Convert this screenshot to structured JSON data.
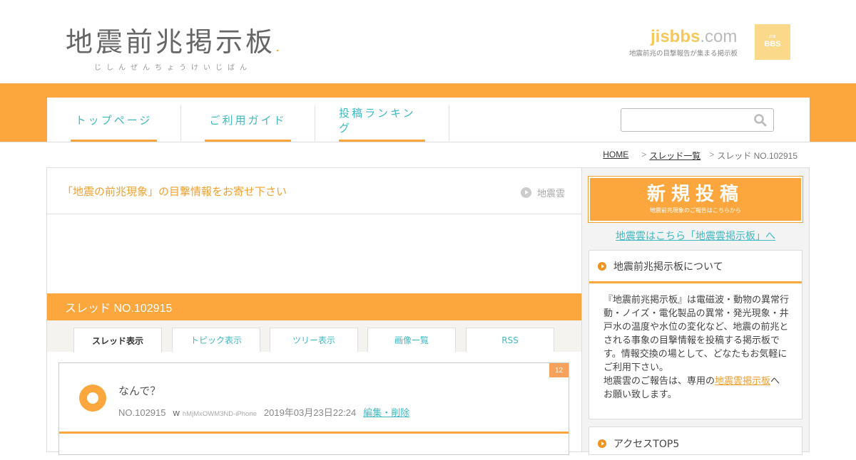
{
  "header": {
    "logo_title": "地震前兆掲示板",
    "logo_reading": "じしんぜんちょうけいじばん",
    "domain_main": "jisbbs",
    "domain_suffix": ".com",
    "tagline": "地震前兆の目撃報告が集まる掲示板",
    "badge_small": "JIS",
    "badge_label": "BBS"
  },
  "nav": {
    "items": [
      {
        "label": "トップページ"
      },
      {
        "label": "ご利用ガイド"
      },
      {
        "label": "投稿ランキング"
      }
    ],
    "search_placeholder": ""
  },
  "breadcrumb": {
    "home": "HOME",
    "sep": ">",
    "threads": "スレッド一覧",
    "current": "スレッド NO.102915"
  },
  "main": {
    "heading": "「地震の前兆現象」の目撃情報をお寄せ下さい",
    "tag": "地震雲",
    "thread_title": "スレッド NO.102915",
    "tabs": [
      {
        "label": "スレッド表示"
      },
      {
        "label": "トピック表示"
      },
      {
        "label": "ツリー表示"
      },
      {
        "label": "画像一覧"
      },
      {
        "label": "RSS"
      }
    ],
    "post": {
      "number_badge": "12",
      "title": "なんで？",
      "no": "NO.102915",
      "author_mark": "w",
      "author_id": "hMjMxOWM3ND-iPhone",
      "date": "2019年03月23日22:24",
      "edit_link": "編集・削除"
    }
  },
  "sidebar": {
    "new_post_label": "新規投稿",
    "new_post_sub": "地震前兆現象のご報告はこちらから",
    "cloud_link": "地震雲はこちら「地震雲掲示板」へ",
    "about_title": "地震前兆掲示板について",
    "about_text_1": "『地震前兆掲示板』は電磁波・動物の異常行動・ノイズ・電化製品の異常・発光現象・井戸水の温度や水位の変化など、地震の前兆とされる事象の目撃情報を投稿する掲示板です。情報交換の場として、どなたもお気軽にご利用下さい。",
    "about_text_2_prefix": "地震雲のご報告は、専用の",
    "about_text_2_link": "地震雲掲示板",
    "about_text_2_suffix": "へお願い致します。",
    "access_title": "アクセスTOP5"
  },
  "colors": {
    "accent_orange": "#fba73d",
    "link_teal": "#3fb9c2"
  }
}
